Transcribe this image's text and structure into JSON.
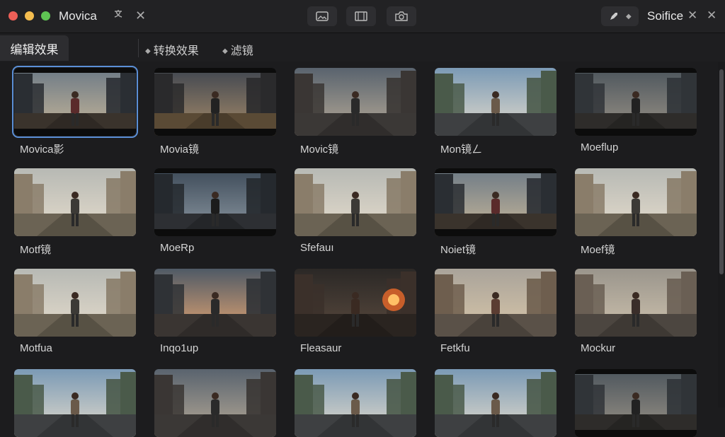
{
  "app": {
    "title": "Movica",
    "panel_title": "Soifice"
  },
  "colors": {
    "accent": "#5b8fd6",
    "bg": "#1c1c1e"
  },
  "tabs": [
    {
      "label": "编辑效果",
      "active": true
    },
    {
      "label": "转换效果",
      "active": false
    },
    {
      "label": "滤镜",
      "active": false
    }
  ],
  "grid": [
    {
      "label": "Movica影",
      "scene": "city-dusk",
      "selected": true
    },
    {
      "label": "Movia镜",
      "scene": "dusk-field"
    },
    {
      "label": "Movic镜",
      "scene": "ruins-sit"
    },
    {
      "label": "Mon镜ㄥ",
      "scene": "road-sky"
    },
    {
      "label": "Moeflup",
      "scene": "ruins-sit2"
    },
    {
      "label": "Motf镜",
      "scene": "street-day"
    },
    {
      "label": "MoeRp",
      "scene": "tower-night"
    },
    {
      "label": "Sfefauı",
      "scene": "street-day"
    },
    {
      "label": "Noiet镜",
      "scene": "city-dusk"
    },
    {
      "label": "Moef镜",
      "scene": "street-day"
    },
    {
      "label": "Motfua",
      "scene": "street-day"
    },
    {
      "label": "Inqo1up",
      "scene": "sunset-road"
    },
    {
      "label": "Fleasaur",
      "scene": "fire"
    },
    {
      "label": "Fetkfu",
      "scene": "street-warm"
    },
    {
      "label": "Mockur",
      "scene": "street-close"
    },
    {
      "label": "",
      "scene": "road-sky"
    },
    {
      "label": "",
      "scene": "ruins-sit"
    },
    {
      "label": "",
      "scene": "road-sky"
    },
    {
      "label": "",
      "scene": "road-sky"
    },
    {
      "label": "",
      "scene": "ruins-sit2"
    }
  ]
}
